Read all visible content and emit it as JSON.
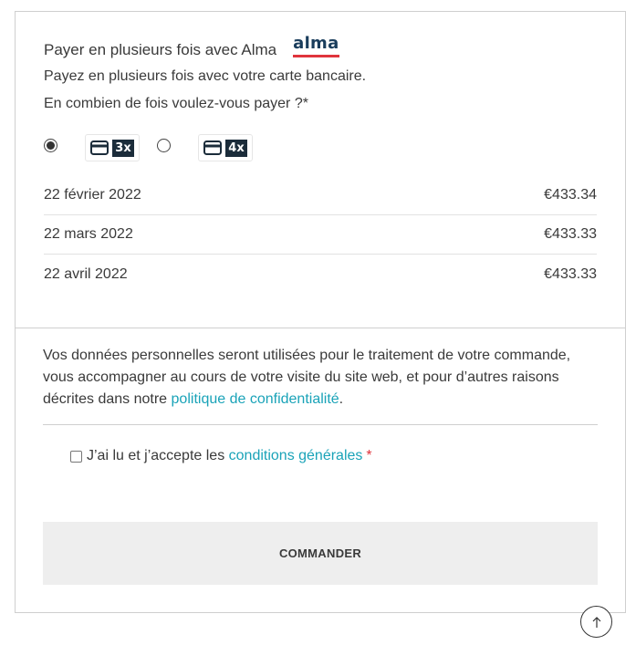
{
  "alma": {
    "title": "Payer en plusieurs fois avec Alma",
    "logo_text": "alma",
    "subtitle": "Payez en plusieurs fois avec votre carte bancaire.",
    "question": "En combien de fois voulez-vous payer ?*",
    "plans": [
      {
        "label": "3x",
        "selected": true
      },
      {
        "label": "4x",
        "selected": false
      }
    ],
    "schedule": [
      {
        "date": "22 février 2022",
        "amount": "€433.34"
      },
      {
        "date": "22 mars 2022",
        "amount": "€433.33"
      },
      {
        "date": "22 avril 2022",
        "amount": "€433.33"
      }
    ]
  },
  "privacy": {
    "text": "Vos données personnelles seront utilisées pour le traitement de votre commande, vous accompagner au cours de votre visite du site web, et pour d’autres raisons décrites dans notre ",
    "link_label": "politique de confidentialité",
    "end": "."
  },
  "terms": {
    "label": "J’ai lu et j’accepte les ",
    "link_label": "conditions générales",
    "required": "*",
    "checked": false
  },
  "order_button": {
    "label": "COMMANDER"
  },
  "icons": {
    "card": "credit-card-icon",
    "scroll_top": "arrow-up-icon"
  },
  "colors": {
    "link": "#1aa3b8",
    "required": "#e0343c",
    "alma_brand": "#1a3d5c",
    "button_bg": "#eeeeee"
  }
}
